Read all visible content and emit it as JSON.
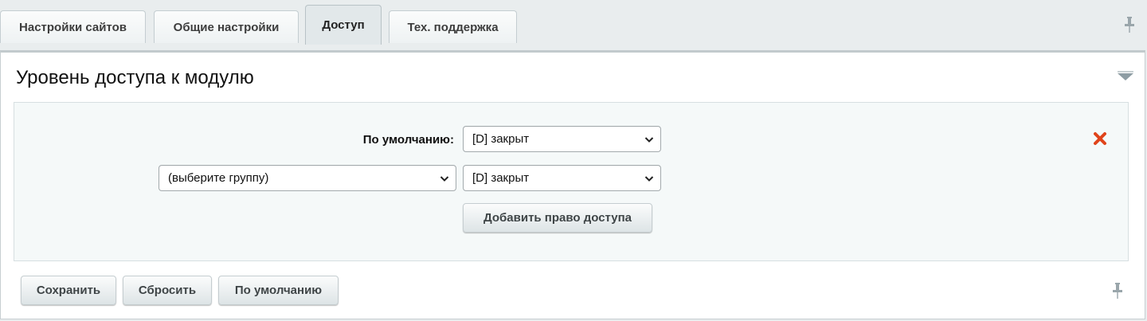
{
  "tabs": [
    {
      "label": "Настройки сайтов",
      "active": false
    },
    {
      "label": "Общие настройки",
      "active": false
    },
    {
      "label": "Доступ",
      "active": true
    },
    {
      "label": "Тех. поддержка",
      "active": false
    }
  ],
  "section": {
    "title": "Уровень доступа к модулю"
  },
  "access_form": {
    "default_label": "По умолчанию:",
    "default_select_value": "[D] закрыт",
    "group_select_value": "(выберите группу)",
    "group_access_value": "[D] закрыт",
    "add_button_label": "Добавить право доступа"
  },
  "footer": {
    "save_label": "Сохранить",
    "reset_label": "Сбросить",
    "defaults_label": "По умолчанию"
  },
  "icons": {
    "pin": "pin-icon",
    "delete": "delete-icon",
    "collapse": "collapse-arrow-icon",
    "dropdown": "chevron-down-icon"
  },
  "colors": {
    "delete_icon": "#e0441b",
    "background": "#e9edee",
    "panel": "#ffffff",
    "form_box": "#f5f9f9"
  }
}
